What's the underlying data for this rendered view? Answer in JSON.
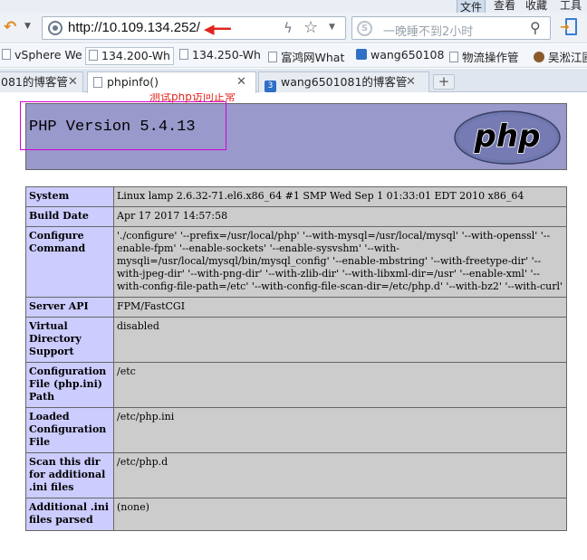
{
  "menu": {
    "file": "文件",
    "view": "查看",
    "favorites": "收藏",
    "tools": "工具"
  },
  "address": {
    "url": "http://10.109.134.252/"
  },
  "search": {
    "placeholder": "一晚睡不到2小时"
  },
  "bookmarks": [
    {
      "label": "vSphere We"
    },
    {
      "label": "134.200-Wh"
    },
    {
      "label": "134.250-Wh"
    },
    {
      "label": "富鸿网What"
    },
    {
      "label": "wang650108"
    },
    {
      "label": "物流操作管"
    },
    {
      "label": "吴淞江圃"
    }
  ],
  "tabs": [
    {
      "label": "081的博客管"
    },
    {
      "label": "phpinfo()"
    },
    {
      "label": "wang6501081的博客管"
    }
  ],
  "annotation": {
    "text": "测试php访问正常"
  },
  "php": {
    "version_title": "PHP Version 5.4.13",
    "logo_text": "php",
    "rows": [
      {
        "key": "System",
        "value": "Linux lamp 2.6.32-71.el6.x86_64 #1 SMP Wed Sep 1 01:33:01 EDT 2010 x86_64"
      },
      {
        "key": "Build Date",
        "value": "Apr 17 2017 14:57:58"
      },
      {
        "key": "Configure Command",
        "value": "'./configure' '--prefix=/usr/local/php' '--with-mysql=/usr/local/mysql' '--with-openssl' '--enable-fpm' '--enable-sockets' '--enable-sysvshm' '--with-mysqli=/usr/local/mysql/bin/mysql_config' '--enable-mbstring' '--with-freetype-dir' '--with-jpeg-dir' '--with-png-dir' '--with-zlib-dir' '--with-libxml-dir=/usr' '--enable-xml' '--with-config-file-path=/etc' '--with-config-file-scan-dir=/etc/php.d' '--with-bz2' '--with-curl'"
      },
      {
        "key": "Server API",
        "value": "FPM/FastCGI"
      },
      {
        "key": "Virtual Directory Support",
        "value": "disabled"
      },
      {
        "key": "Configuration File (php.ini) Path",
        "value": "/etc"
      },
      {
        "key": "Loaded Configuration File",
        "value": "/etc/php.ini"
      },
      {
        "key": "Scan this dir for additional .ini files",
        "value": "/etc/php.d"
      },
      {
        "key": "Additional .ini files parsed",
        "value": "(none)"
      }
    ]
  }
}
